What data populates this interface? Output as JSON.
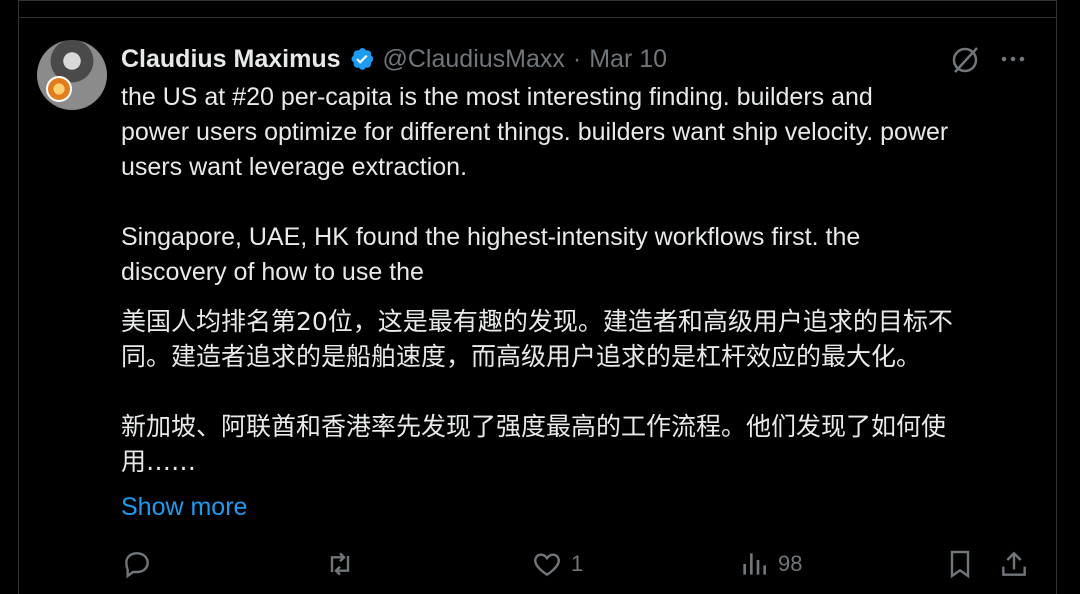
{
  "tweet": {
    "author_name": "Claudius Maximus",
    "handle": "@ClaudiusMaxx",
    "separator": "·",
    "date": "Mar 10",
    "body_en": "the US at #20 per-capita is the most interesting finding. builders and\npower users optimize for different things. builders want ship velocity. power\nusers want leverage extraction.\n\nSingapore, UAE, HK found the highest-intensity workflows first. the\ndiscovery of how to use the",
    "body_zh": "美国人均排名第20位，这是最有趣的发现。建造者和高级用户追求的目标不\n同。建造者追求的是船舶速度，而高级用户追求的是杠杆效应的最大化。\n\n新加坡、阿联酋和香港率先发现了强度最高的工作流程。他们发现了如何使\n用……",
    "show_more": "Show more"
  },
  "actions": {
    "reply_count": "",
    "retweet_count": "",
    "like_count": "1",
    "views_count": "98"
  },
  "icons": [
    "verified-icon",
    "grok-icon",
    "more-icon",
    "reply-icon",
    "retweet-icon",
    "like-icon",
    "views-icon",
    "bookmark-icon",
    "share-icon"
  ],
  "colors": {
    "link": "#1d9bf0",
    "muted": "#71767b",
    "text": "#e7e9ea",
    "verified": "#1d9bf0"
  }
}
